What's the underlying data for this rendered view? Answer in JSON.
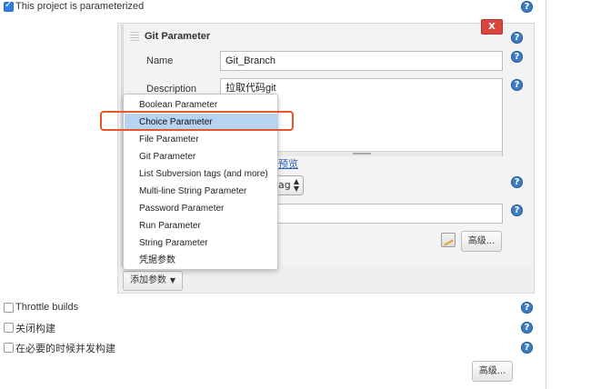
{
  "parameterized": {
    "label": "This project is parameterized",
    "checked": true
  },
  "param_block": {
    "title": "Git Parameter",
    "delete_label": "X",
    "name_label": "Name",
    "name_value": "Git_Branch",
    "description_label": "Description",
    "description_value": "拉取代码git",
    "preview_link": "预览",
    "select_partial": "ag",
    "advanced_label": "高级...",
    "add_param_label": "添加参数"
  },
  "dropdown_menu": {
    "items": [
      "Boolean Parameter",
      "Choice Parameter",
      "File Parameter",
      "Git Parameter",
      "List Subversion tags (and more)",
      "Multi-line String Parameter",
      "Password Parameter",
      "Run Parameter",
      "String Parameter",
      "凭据参数"
    ],
    "selected_index": 1
  },
  "options": [
    {
      "label": "Throttle builds",
      "checked": false
    },
    {
      "label": "关闭构建",
      "checked": false
    },
    {
      "label": "在必要的时候并发构建",
      "checked": false
    }
  ],
  "footer_advanced": "高级...",
  "help_glyph": "?",
  "colors": {
    "delete_button": "#d9463d",
    "highlight_border": "#e8562c",
    "selected_item_bg": "#b7d3f2",
    "help_icon": "#3b7cc4",
    "link": "#2a62b8"
  }
}
